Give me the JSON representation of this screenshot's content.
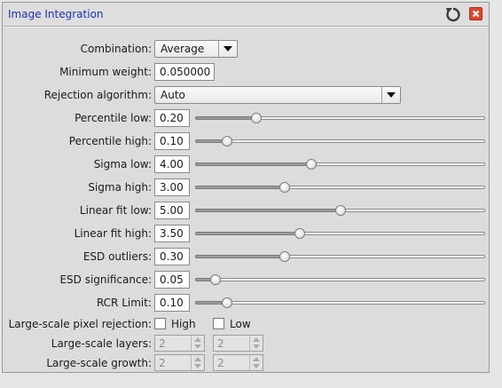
{
  "window": {
    "title": "Image Integration",
    "icons": {
      "reset": "reset-icon",
      "close": "close-icon"
    },
    "colors": {
      "title": "#1f2fbf",
      "close": "#e0462e"
    }
  },
  "combination": {
    "label": "Combination:",
    "value": "Average"
  },
  "minimum_weight": {
    "label": "Minimum weight:",
    "value": "0.050000"
  },
  "rejection_algorithm": {
    "label": "Rejection algorithm:",
    "value": "Auto"
  },
  "sliders": [
    {
      "label": "Percentile low:",
      "value": "0.20",
      "level": 0.21
    },
    {
      "label": "Percentile high:",
      "value": "0.10",
      "level": 0.11
    },
    {
      "label": "Sigma low:",
      "value": "4.00",
      "level": 0.4
    },
    {
      "label": "Sigma high:",
      "value": "3.00",
      "level": 0.31
    },
    {
      "label": "Linear fit low:",
      "value": "5.00",
      "level": 0.5
    },
    {
      "label": "Linear fit high:",
      "value": "3.50",
      "level": 0.36
    },
    {
      "label": "ESD outliers:",
      "value": "0.30",
      "level": 0.31
    },
    {
      "label": "ESD significance:",
      "value": "0.05",
      "level": 0.07
    },
    {
      "label": "RCR Limit:",
      "value": "0.10",
      "level": 0.11
    }
  ],
  "large_scale_rejection": {
    "label": "Large-scale pixel rejection:",
    "high_label": "High",
    "low_label": "Low",
    "high_checked": false,
    "low_checked": false
  },
  "large_scale_layers": {
    "label": "Large-scale layers:",
    "high": "2",
    "low": "2"
  },
  "large_scale_growth": {
    "label": "Large-scale growth:",
    "high": "2",
    "low": "2"
  }
}
